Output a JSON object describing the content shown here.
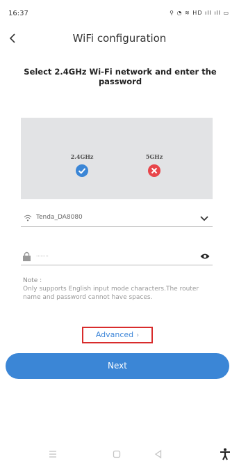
{
  "status_bar": {
    "time": "16:37",
    "icons_text": "⚲ ◔ ≋ HD ıll ıll ▭"
  },
  "header": {
    "title": "WiFi configuration"
  },
  "instruction": "Select 2.4GHz Wi-Fi network and enter the password",
  "bands": [
    {
      "label": "2.4GHz",
      "status": "supported",
      "color": "#3b86d6",
      "icon": "check-icon"
    },
    {
      "label": "5GHz",
      "status": "unsupported",
      "color": "#e8454a",
      "icon": "cross-icon"
    }
  ],
  "wifi": {
    "ssid": "Tenda_DA8080"
  },
  "password": {
    "value": "........"
  },
  "note": {
    "title": "Note :",
    "text": "Only supports English input mode characters.The router name and password cannot have spaces."
  },
  "advanced": {
    "label": "Advanced",
    "chevron": "›"
  },
  "next_button": {
    "label": "Next"
  },
  "colors": {
    "accent": "#3b86d6",
    "highlight_border": "#d82c2c",
    "panel": "#e2e3e5"
  }
}
